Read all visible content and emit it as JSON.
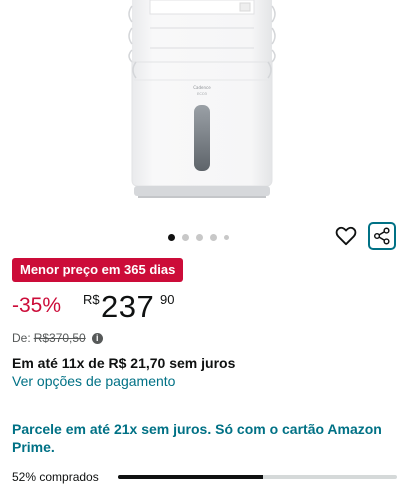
{
  "product_image": {
    "brand_text": "Cadence",
    "model_text": "ECO3"
  },
  "carousel": {
    "total_dots": 5,
    "active_index": 0
  },
  "actions": {
    "wishlist_icon": "heart-icon",
    "share_icon": "share-icon"
  },
  "deal": {
    "badge": "Menor preço em 365 dias",
    "badge_color": "#cc0c39"
  },
  "price": {
    "discount": "-35%",
    "currency": "R$",
    "whole": "237",
    "fraction": "90"
  },
  "list_price": {
    "label": "De:",
    "value": "R$370,50",
    "info_icon": "info-icon"
  },
  "installments": {
    "text": "Em até 11x de R$ 21,70 sem juros"
  },
  "payment_link": "Ver opções de pagamento",
  "promo": "Parcele em até 21x sem juros. Só com o cartão Amazon Prime.",
  "bought": {
    "label": "52% comprados",
    "percent": 52
  },
  "colors": {
    "link": "#007185",
    "text": "#0f1111",
    "muted": "#565959"
  }
}
